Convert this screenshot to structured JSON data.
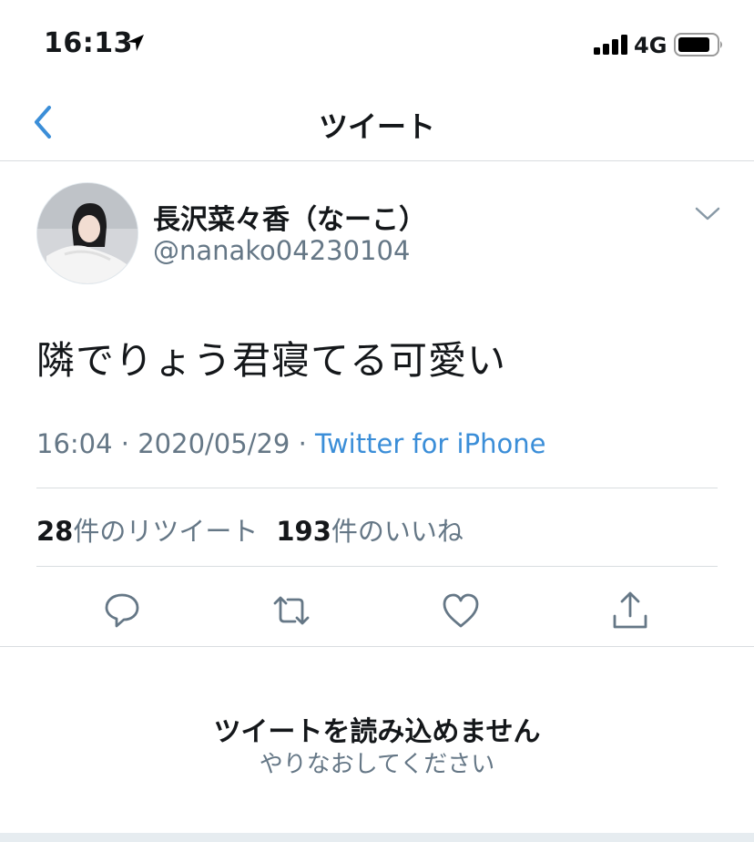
{
  "status_bar": {
    "time": "16:13",
    "network": "4G",
    "icons": [
      "location-arrow-icon",
      "signal-icon",
      "battery-icon"
    ]
  },
  "nav": {
    "title": "ツイート",
    "back_icon": "chevron-left-icon"
  },
  "tweet": {
    "author_name": "長沢菜々香（なーこ）",
    "author_handle": "@nanako04230104",
    "text": "隣でりょう君寝てる可愛い",
    "time": "16:04",
    "separator": "·",
    "date": "2020/05/29",
    "source": "Twitter for iPhone",
    "retweet_count": "28",
    "retweet_label": "件のリツイート",
    "like_count": "193",
    "like_label": "件のいいね"
  },
  "actions": [
    "reply-icon",
    "retweet-icon",
    "like-icon",
    "share-icon"
  ],
  "error": {
    "title": "ツイートを読み込めません",
    "retry": "やりなおしてください"
  },
  "colors": {
    "accent": "#3b8ed8",
    "muted": "#657786",
    "divider": "#d9dde0",
    "text": "#14171a"
  }
}
